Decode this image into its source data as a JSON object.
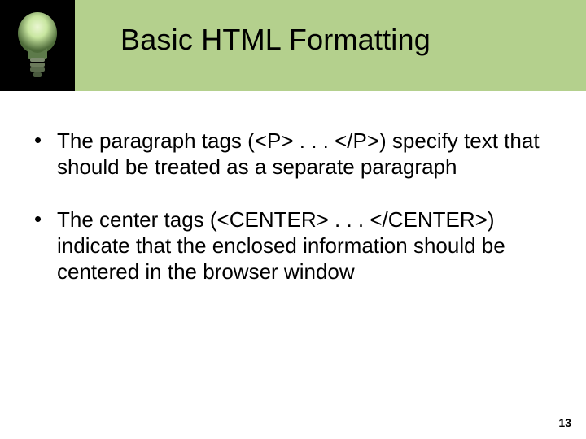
{
  "header": {
    "title": "Basic HTML Formatting",
    "icon_name": "lightbulb-icon",
    "band_color": "#b4d08d",
    "icon_box_bg": "#000000",
    "bulb_glow": "#c8e6a0",
    "bulb_base": "#6b7a5b"
  },
  "bullets": [
    "The paragraph tags (<P> . . .  </P>) specify text that should be treated as a separate paragraph",
    "The center tags (<CENTER> . . . </CENTER>) indicate that the enclosed information should be centered in the browser window"
  ],
  "page_number": "13"
}
